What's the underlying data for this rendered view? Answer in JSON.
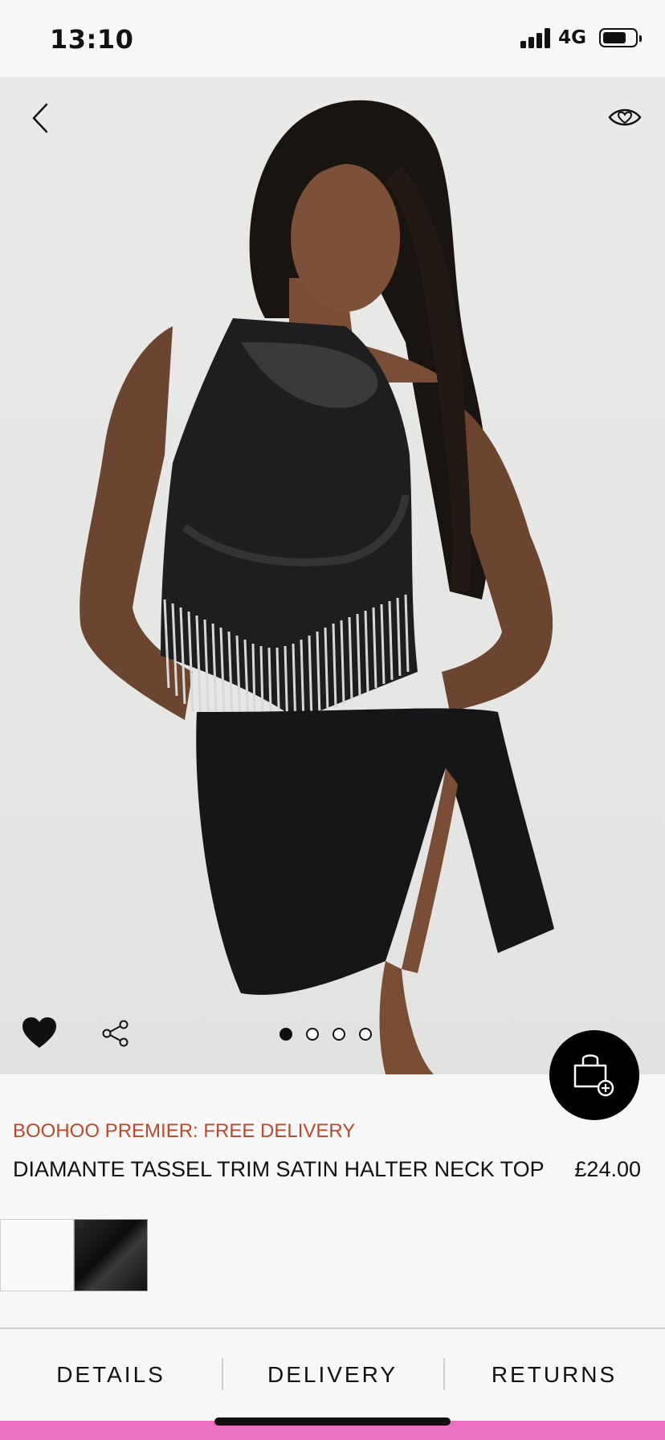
{
  "status_bar": {
    "time": "13:10",
    "network": "4G",
    "battery_level": 0.62
  },
  "gallery": {
    "image_count": 4,
    "active_index": 0
  },
  "product": {
    "promo": "BOOHOO PREMIER: FREE DELIVERY",
    "title": "DIAMANTE TASSEL TRIM SATIN HALTER NECK TOP",
    "price": "£24.00",
    "colors": [
      "white",
      "black"
    ]
  },
  "tabs": [
    {
      "label": "DETAILS"
    },
    {
      "label": "DELIVERY"
    },
    {
      "label": "RETURNS"
    }
  ],
  "colors": {
    "promo_text": "#b9492a",
    "bottom_strip": "#ec6fc0",
    "bag_button": "#000000"
  },
  "icons": [
    "back-chevron-icon",
    "eye-heart-icon",
    "heart-filled-icon",
    "share-icon",
    "shopping-bag-add-icon"
  ]
}
